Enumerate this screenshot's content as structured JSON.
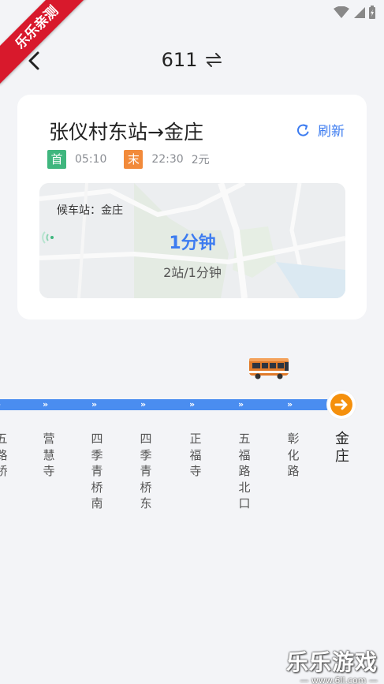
{
  "watermark_corner": "乐乐亲测",
  "header": {
    "route_number": "611"
  },
  "card": {
    "line_name": "张仪村东站→金庄",
    "refresh_label": "刷新",
    "first_tag": "首",
    "first_time": "05:10",
    "last_tag": "末",
    "last_time": "22:30",
    "price": "2元",
    "waiting_station": "候车站：金庄",
    "eta": "1分钟",
    "eta_detail": "2站/1分钟"
  },
  "stops": [
    "五路桥",
    "营慧寺",
    "四季青桥南",
    "四季青桥东",
    "正福寺",
    "五福路北口",
    "彰化路",
    "金庄"
  ],
  "watermark_site": {
    "title": "乐乐游戏",
    "url": "— www.6ll.com —"
  },
  "colors": {
    "accent": "#3d7cf0",
    "track": "#4a8df0",
    "first_tag": "#3fb67e",
    "last_tag": "#f28a3a",
    "terminal": "#f5900c",
    "corner_ribbon": "#d8192c"
  }
}
